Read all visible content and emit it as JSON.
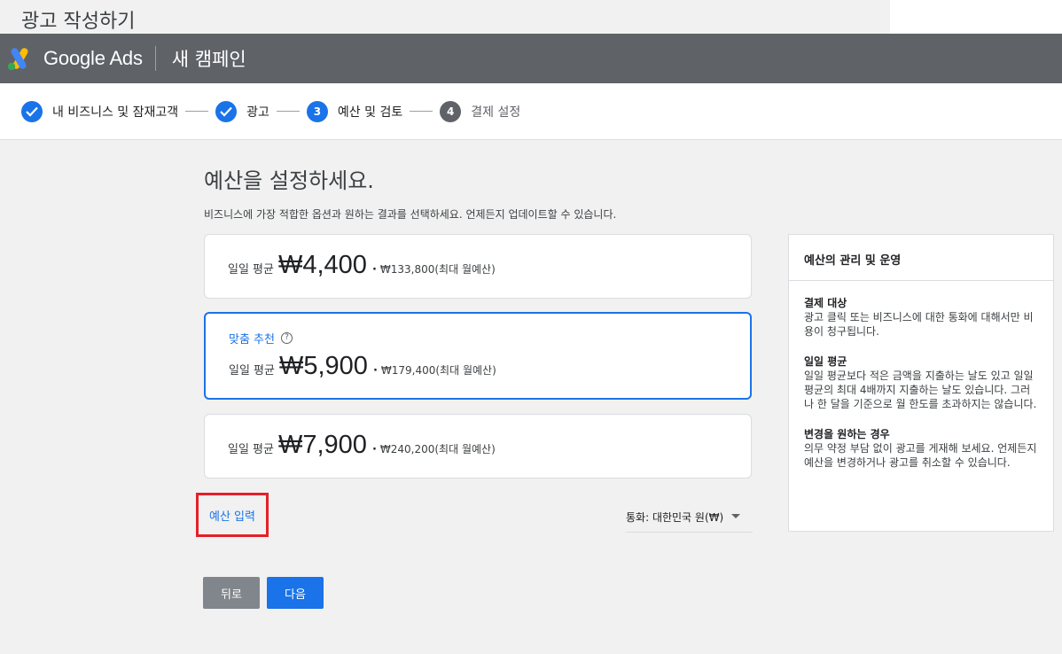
{
  "window": {
    "title": "광고 작성하기"
  },
  "header": {
    "brand": "Google Ads",
    "campaign": "새 캠페인"
  },
  "stepper": [
    {
      "label": "내 비즈니스 및 잠재고객",
      "state": "done"
    },
    {
      "label": "광고",
      "state": "done"
    },
    {
      "number": "3",
      "label": "예산 및 검토",
      "state": "active"
    },
    {
      "number": "4",
      "label": "결제 설정",
      "state": "inactive"
    }
  ],
  "main": {
    "heading": "예산을 설정하세요.",
    "subtext": "비즈니스에 가장 적합한 옵션과 원하는 결과를 선택하세요. 언제든지 업데이트할 수 있습니다.",
    "options": [
      {
        "label": "일일 평균",
        "price": "₩4,400",
        "dot": "·",
        "monthly": "₩133,800(최대 월예산)",
        "selected": false
      },
      {
        "recommend": "맞춤 추천",
        "label": "일일 평균",
        "price": "₩5,900",
        "dot": "·",
        "monthly": "₩179,400(최대 월예산)",
        "selected": true
      },
      {
        "label": "일일 평균",
        "price": "₩7,900",
        "dot": "·",
        "monthly": "₩240,200(최대 월예산)",
        "selected": false
      }
    ],
    "custom_budget": "예산 입력",
    "currency": "통화: 대한민국 원(₩)",
    "back_button": "뒤로",
    "next_button": "다음"
  },
  "side_panel": {
    "title": "예산의 관리 및 운영",
    "sections": [
      {
        "title": "결제 대상",
        "text": "광고 클릭 또는 비즈니스에 대한 통화에 대해서만 비용이 청구됩니다."
      },
      {
        "title": "일일 평균",
        "text": "일일 평균보다 적은 금액을 지출하는 날도 있고 일일 평균의 최대 4배까지 지출하는 날도 있습니다. 그러나 한 달을 기준으로 월 한도를 초과하지는 않습니다."
      },
      {
        "title": "변경을 원하는 경우",
        "text": "의무 약정 부담 없이 광고를 게재해 보세요. 언제든지 예산을 변경하거나 광고를 취소할 수 있습니다."
      }
    ]
  },
  "colors": {
    "accent": "#1a73e8",
    "topbar": "#5f6368",
    "highlight": "#e5202a"
  }
}
